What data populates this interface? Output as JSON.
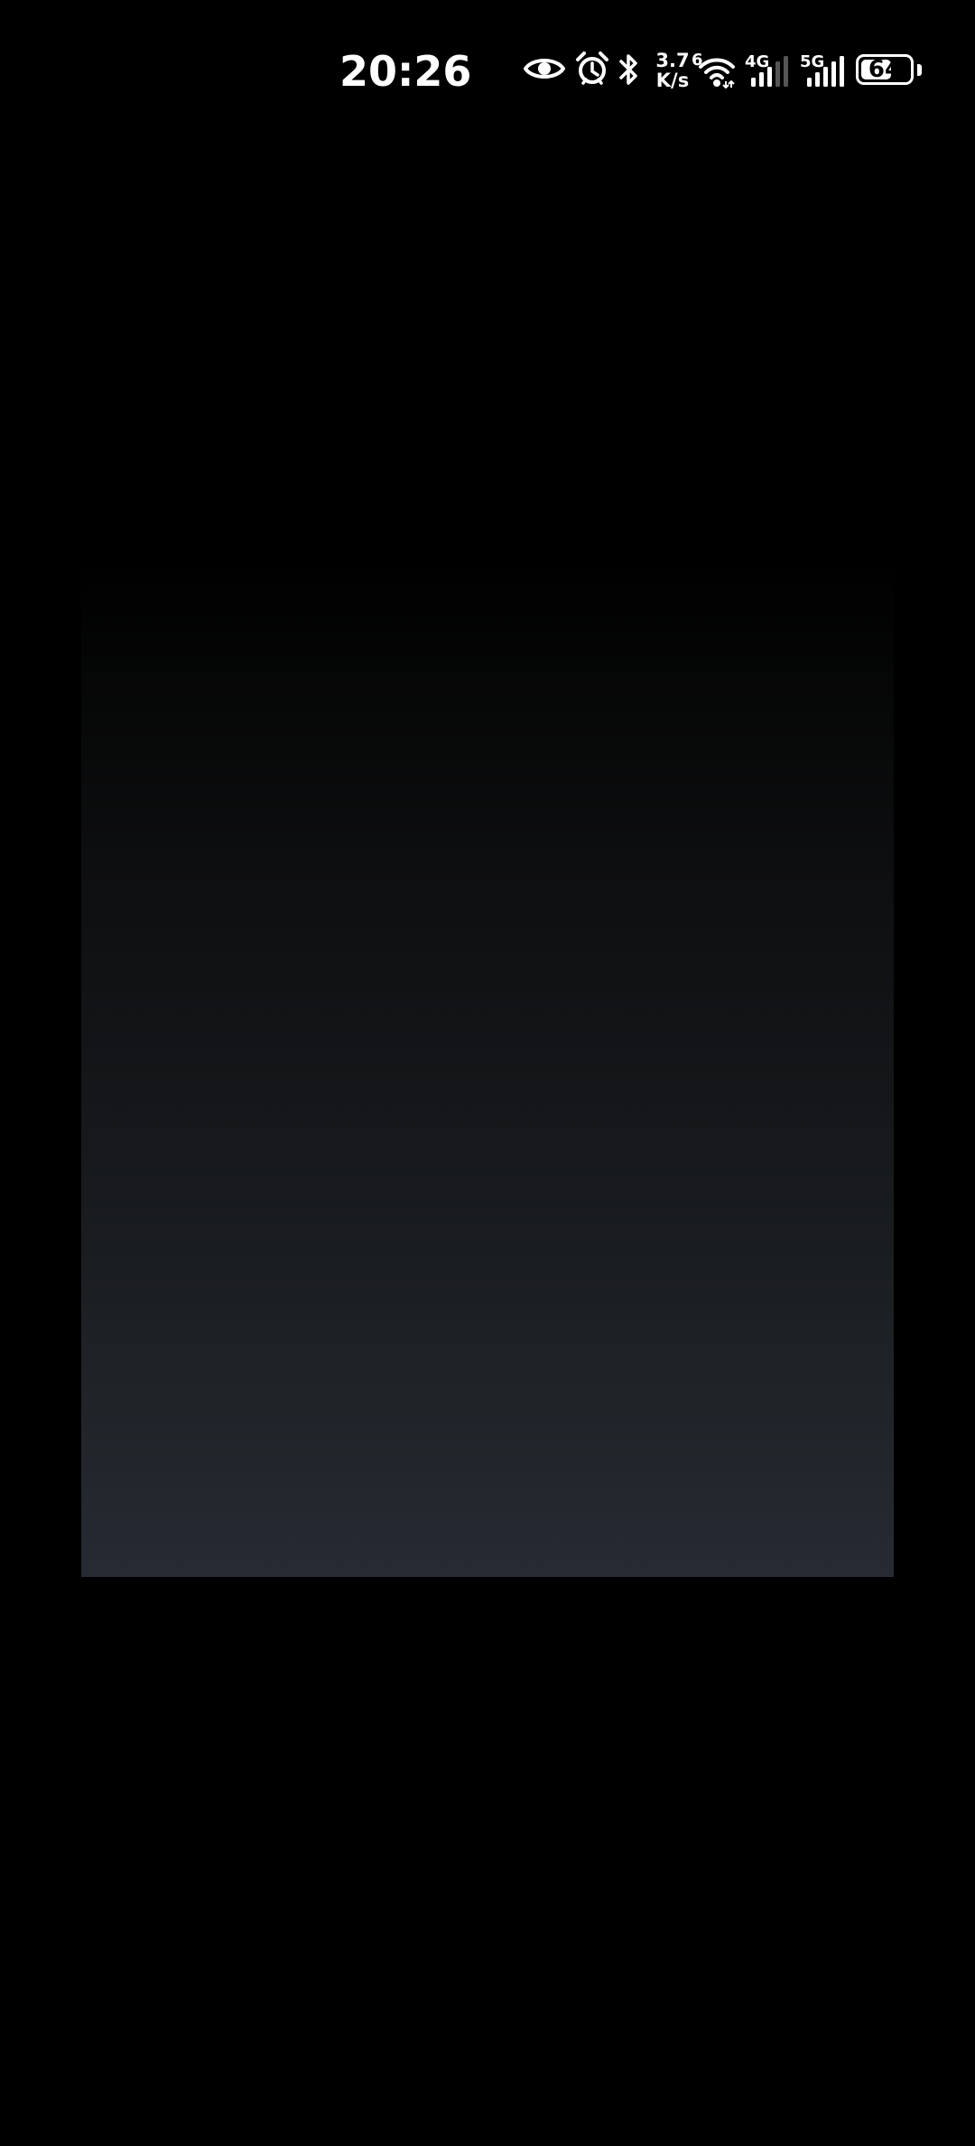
{
  "status_bar": {
    "time": "20:26",
    "net_speed_value": "3.7",
    "net_speed_unit": "K/s",
    "wifi_tag": "6",
    "sim1_tag": "4G",
    "sim2_tag": "5G",
    "battery_level": "64",
    "battery_percent": 64,
    "icons": [
      "eye-icon",
      "alarm-clock-icon",
      "bluetooth-icon",
      "wifi-icon",
      "signal-4g-icon",
      "signal-5g-icon",
      "battery-icon"
    ]
  },
  "colors": {
    "background": "#000000",
    "panel_top": "#000000",
    "panel_bottom": "#262a33",
    "status_text": "#ffffff"
  }
}
